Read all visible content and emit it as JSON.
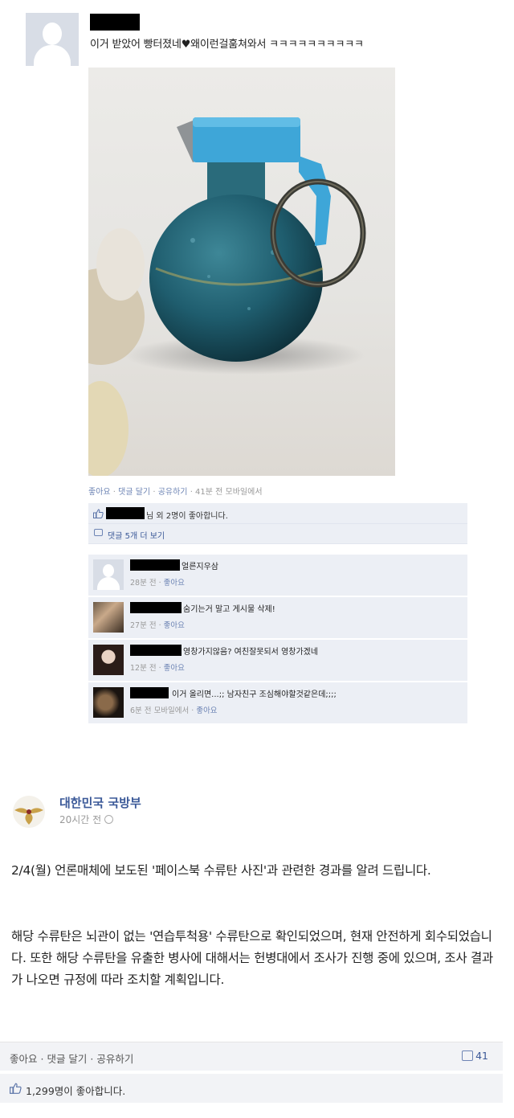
{
  "post1": {
    "text": "이거 받았어 빵터졌네♥왜이런걸훔쳐와서 ㅋㅋㅋㅋㅋㅋㅋㅋㅋㅋ",
    "meta": {
      "like": "좋아요",
      "comment": "댓글 달기",
      "share": "공유하기",
      "time": "41분 전 모바일에서"
    },
    "likes_text": "님 외 2명이 좋아합니다.",
    "more_comments": "댓글 5개 더 보기",
    "comments": [
      {
        "text": "얼른지우삼",
        "meta_time": "28분 전",
        "meta_like": "좋아요"
      },
      {
        "text": "숨기는거 말고 게시물 삭제!",
        "meta_time": "27분 전",
        "meta_like": "좋아요"
      },
      {
        "text": "영창가지않음? 여친잘못되서 영창가겠네",
        "meta_time": "12분 전",
        "meta_like": "좋아요"
      },
      {
        "text": "이거 올리면...;; 남자친구 조심해야할것같은데;;;;",
        "meta_time": "6분 전 모바일에서",
        "meta_like": "좋아요"
      }
    ]
  },
  "post2": {
    "page_name": "대한민국 국방부",
    "time": "20시간 전",
    "para1": "2/4(월) 언론매체에 보도된 '페이스북 수류탄 사진'과 관련한 경과를 알려 드립니다.",
    "para2": "해당 수류탄은 뇌관이 없는 '연습투척용' 수류탄으로 확인되었으며, 현재 안전하게 회수되었습니다. 또한 해당 수류탄을 유출한 병사에 대해서는 헌병대에서 조사가 진행 중에 있으며, 조사 결과가 나오면 규정에 따라 조치할 계획입니다.",
    "actions": {
      "like": "좋아요",
      "comment": "댓글 달기",
      "share": "공유하기"
    },
    "comment_count": "41",
    "likes_text": "1,299명이 좋아합니다."
  },
  "colors": {
    "link": "#3b5998",
    "meta_link": "#6d84b4",
    "comment_bg": "#eceff5",
    "grenade_body": "#1f5d6e",
    "grenade_cap": "#3ea6d8"
  },
  "icons": [
    "default-avatar-icon",
    "thumbs-up-icon",
    "comment-bubble-icon",
    "globe-icon",
    "eagle-emblem-icon"
  ]
}
